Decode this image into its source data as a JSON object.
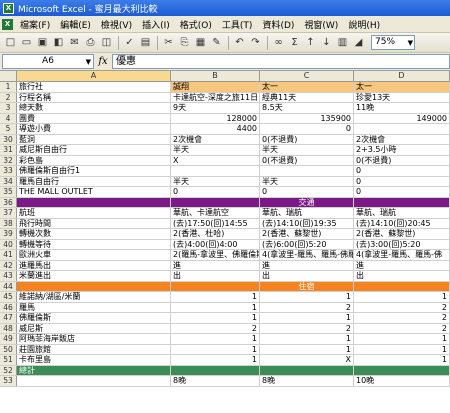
{
  "window": {
    "title": "Microsoft Excel - 蜜月最大利比較"
  },
  "menu": [
    "檔案(F)",
    "編輯(E)",
    "檢視(V)",
    "插入(I)",
    "格式(O)",
    "工具(T)",
    "資料(D)",
    "視窗(W)",
    "說明(H)"
  ],
  "toolbar": {
    "zoom": "75%"
  },
  "formula_bar": {
    "name_box": "A6",
    "fx": "fx",
    "content": "優惠"
  },
  "columns": [
    "A",
    "B",
    "C",
    "D"
  ],
  "rows": [
    {
      "n": "1",
      "a": "旅行社",
      "b": "誠翔",
      "c": "太一",
      "d": "太一",
      "type": "header"
    },
    {
      "n": "2",
      "a": "行程名稱",
      "b": "卡達航空-深度之旅11日",
      "c": "經典11天",
      "d": "珍愛13天"
    },
    {
      "n": "3",
      "a": "總天數",
      "b": "9天",
      "c": "8.5天",
      "d": "11晚"
    },
    {
      "n": "4",
      "a": "團費",
      "b": "128000",
      "c": "135900",
      "d": "149000",
      "numeric": true
    },
    {
      "n": "5",
      "a": "導遊小費",
      "b": "4400",
      "c": "0",
      "d": "",
      "numeric": true
    },
    {
      "n": "30",
      "a": "藍洞",
      "b": "2次機會",
      "c": "0(不退費)",
      "d": "2次機會"
    },
    {
      "n": "31",
      "a": "威尼斯自由行",
      "b": "半天",
      "c": "半天",
      "d": "2+3.5小時"
    },
    {
      "n": "32",
      "a": "彩色島",
      "b": "X",
      "c": "0(不退費)",
      "d": "0(不退費)"
    },
    {
      "n": "33",
      "a": "佛羅倫斯自由行1",
      "b": "",
      "c": "",
      "d": "0"
    },
    {
      "n": "34",
      "a": "羅馬自由行",
      "b": "半天",
      "c": "半天",
      "d": "0"
    },
    {
      "n": "35",
      "a": "THE MALL OUTLET",
      "b": "0",
      "c": "0",
      "d": "0"
    },
    {
      "n": "36",
      "band": "交通",
      "type": "band-purple"
    },
    {
      "n": "37",
      "a": "航班",
      "b": "華航、卡達航空",
      "c": "華航、瑞航",
      "d": "華航、瑞航"
    },
    {
      "n": "38",
      "a": "飛行時間",
      "b": "(去)17:50(回)14:55",
      "c": "(去)14:10(回)19:35",
      "d": "(去)14:10(回)20:45"
    },
    {
      "n": "39",
      "a": "轉機次數",
      "b": "2(香港、杜哈)",
      "c": "2(香港、蘇黎世)",
      "d": "2(香港、蘇黎世)"
    },
    {
      "n": "40",
      "a": "轉機等待",
      "b": "(去)4:00(回)4:00",
      "c": "(去)6:00(回)5:20",
      "d": "(去)3:00(回)5:20"
    },
    {
      "n": "41",
      "a": "歐洲火車",
      "b": "2(羅馬-拿波里、佛羅倫斯",
      "c": "4(拿波里-羅馬、羅馬-佛羅",
      "d": "4(拿波里-羅馬、羅馬-佛"
    },
    {
      "n": "42",
      "a": "進羅馬出",
      "b": "進",
      "c": "進",
      "d": "進"
    },
    {
      "n": "43",
      "a": "米蘭進出",
      "b": "出",
      "c": "出",
      "d": "出"
    },
    {
      "n": "44",
      "band": "住宿",
      "type": "band-orange"
    },
    {
      "n": "45",
      "a": "維諾納/湖區/米蘭",
      "b": "1",
      "c": "1",
      "d": "1",
      "numeric": true
    },
    {
      "n": "46",
      "a": "羅馬",
      "b": "1",
      "c": "2",
      "d": "2",
      "numeric": true
    },
    {
      "n": "47",
      "a": "佛羅倫斯",
      "b": "1",
      "c": "1",
      "d": "2",
      "numeric": true
    },
    {
      "n": "48",
      "a": "威尼斯",
      "b": "2",
      "c": "2",
      "d": "2",
      "numeric": true
    },
    {
      "n": "49",
      "a": "阿瑪菲海岸飯店",
      "b": "1",
      "c": "1",
      "d": "1",
      "numeric": true
    },
    {
      "n": "50",
      "a": "莊園旅館",
      "b": "1",
      "c": "1",
      "d": "1",
      "numeric": true
    },
    {
      "n": "51",
      "a": "卡布里島",
      "b": "1",
      "c": "X",
      "d": "1",
      "numeric": true
    },
    {
      "n": "52",
      "a": "總計",
      "b": "",
      "c": "",
      "d": "",
      "type": "band-green"
    },
    {
      "n": "53",
      "a": "",
      "b": "8晚",
      "c": "8晚",
      "d": "10晚"
    }
  ],
  "colors": {
    "header": "#f7c77d",
    "transport_band": "#7a1a86",
    "lodging_band": "#f5831f",
    "total_band": "#3c8c55"
  }
}
